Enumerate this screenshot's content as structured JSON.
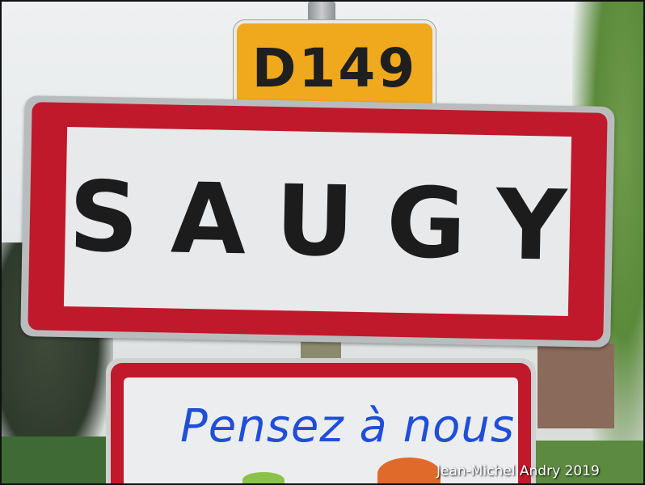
{
  "signs": {
    "road_number": "D149",
    "town_name": "SAUGY",
    "message": "Pensez à nous"
  },
  "credit": "Jean-Michel Andry 2019",
  "colors": {
    "road_plate": "#f0a81c",
    "sign_border": "#c0192b",
    "sign_face": "#e8e9ea",
    "message_ink": "#1f4fd8"
  }
}
